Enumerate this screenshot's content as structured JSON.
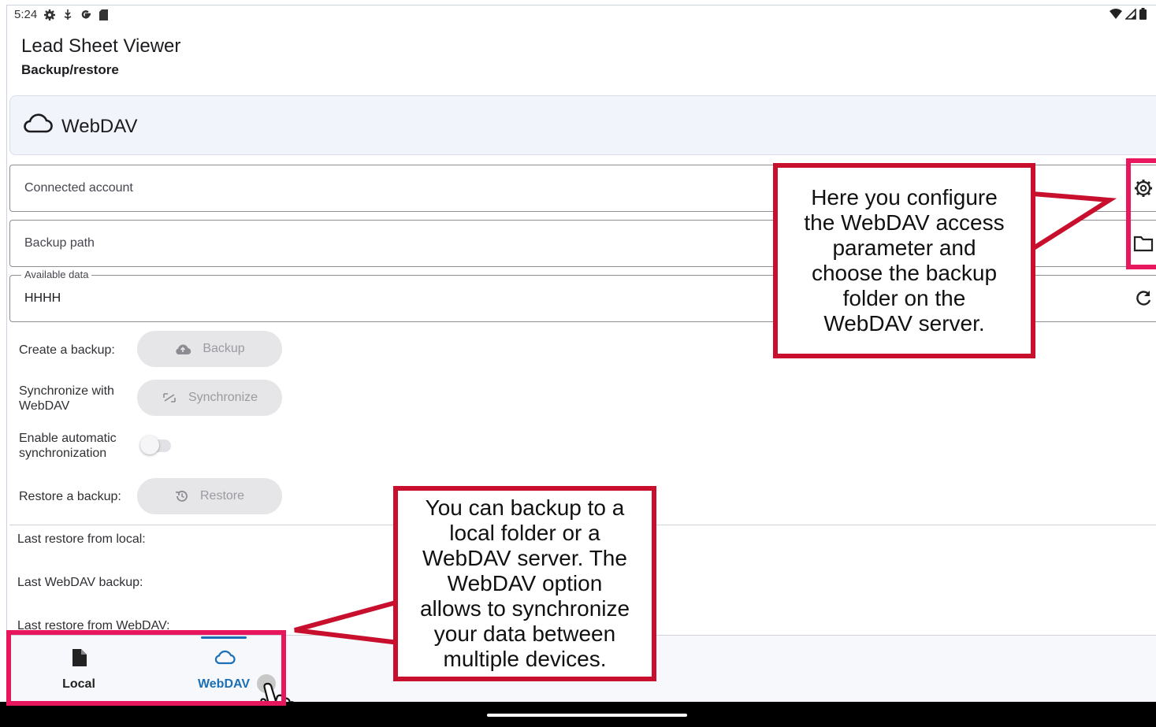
{
  "status_bar": {
    "time": "5:24",
    "left_icons": [
      "gear-icon",
      "usb-icon",
      "google-icon",
      "sdcard-icon"
    ],
    "right_icons": [
      "wifi-icon",
      "signal-icon",
      "battery-icon"
    ]
  },
  "app_bar": {
    "title": "Lead Sheet Viewer",
    "subtitle": "Backup/restore"
  },
  "section": {
    "title": "WebDAV",
    "icon": "cloud-icon"
  },
  "fields": {
    "connected_account": {
      "label": "Connected account",
      "action_icon": "settings-icon"
    },
    "backup_path": {
      "label": "Backup path",
      "action_icon": "folder-icon"
    },
    "available_data": {
      "label": "Available data",
      "value": "HHHH",
      "action_icon": "refresh-icon"
    }
  },
  "actions": {
    "create_backup": {
      "label": "Create a backup:",
      "button": "Backup",
      "icon": "cloud-upload-icon"
    },
    "synchronize": {
      "label_line1": "Synchronize with",
      "label_line2": "WebDAV",
      "button": "Synchronize",
      "icon": "sync-icon"
    },
    "auto_sync": {
      "label_line1": "Enable automatic",
      "label_line2": "synchronization",
      "enabled": false
    },
    "restore": {
      "label": "Restore a backup:",
      "button": "Restore",
      "icon": "history-icon"
    }
  },
  "info": {
    "last_restore_local": "Last restore from local:",
    "last_webdav_backup": "Last WebDAV backup:",
    "last_restore_webdav": "Last restore from WebDAV:"
  },
  "bottom_nav": {
    "items": [
      {
        "label": "Local",
        "icon": "file-icon",
        "selected": false
      },
      {
        "label": "WebDAV",
        "icon": "cloud-icon",
        "selected": true
      }
    ]
  },
  "annotations": {
    "top_callout_lines": [
      "Here you configure",
      "the WebDAV access",
      "parameter and",
      "choose the backup",
      "folder on the",
      "WebDAV server."
    ],
    "bottom_callout_lines": [
      "You can backup to a",
      "local folder or a",
      "WebDAV server. The",
      "WebDAV option",
      "allows to synchronize",
      "your data between",
      "multiple devices."
    ]
  },
  "colors": {
    "accent": "#1b6fb7",
    "callout_border": "#c8102e",
    "highlight_border": "#e8175d",
    "section_bg": "#f1f4fa"
  }
}
